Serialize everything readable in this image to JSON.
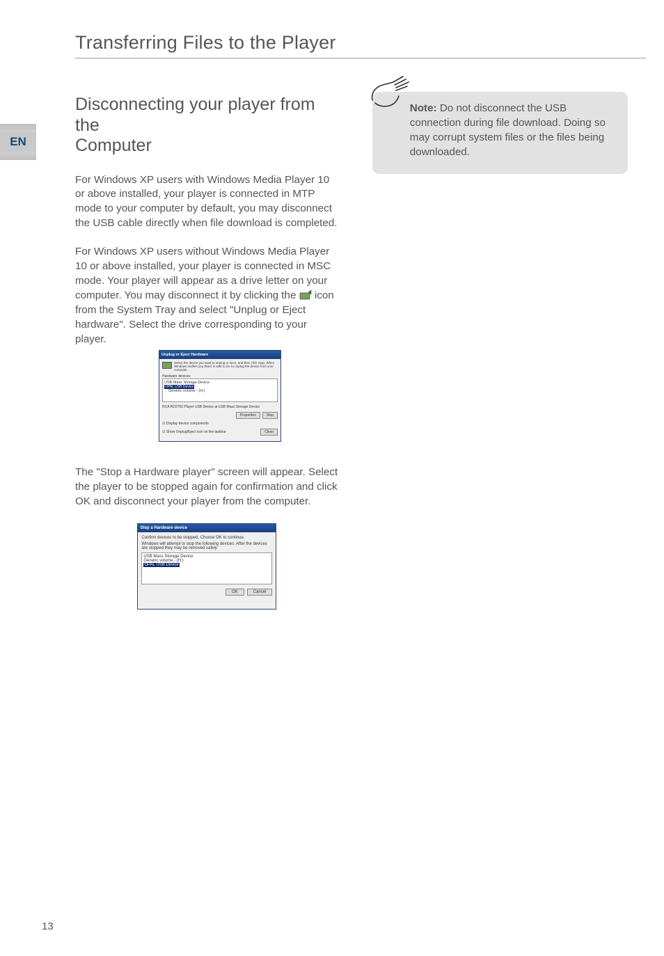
{
  "lang_tab": "EN",
  "section_title": "Transferring Files to the Player",
  "sub_title_line1": "Disconnecting your player from the",
  "sub_title_line2": "Computer",
  "para1": "For Windows XP users with Windows Media Player 10 or above installed, your player is connected in MTP mode to your computer by default, you may disconnect the USB cable directly when file download is completed.",
  "para2_a": "For Windows XP users without Windows Media Player 10 or above installed, your player is connected in MSC  mode. Your player will appear as a drive letter on your computer. You may disconnect it by clicking the ",
  "para2_b": " icon from the System Tray and select \"Unplug or Eject hardware\". Select the drive corresponding to your player.",
  "para3": "The \"Stop a Hardware player\" screen will appear. Select the player to be stopped again for confirmation and click OK and disconnect your player from the computer.",
  "note_label": "Note:",
  "note_body": " Do not disconnect the USB connection during file download. Doing so may corrupt system files or the files being downloaded.",
  "page_number": "13",
  "shot1": {
    "title": "Unplug or Eject Hardware",
    "helper": "Select the device you want to unplug or eject, and then click Stop. When Windows notifies you that it is safe to do so unplug the device from your computer.",
    "hw_label": "Hardware devices:",
    "tree_top": "USB Mass Storage Device",
    "tree_sel": "OPAL USB Device",
    "tree_sub": "Generic volume - (H:)",
    "dev_line": "RCA RD2760 Player USB Device at USB Mass Storage Device",
    "btn_props": "Properties",
    "btn_stop": "Stop",
    "chk1": "Display device components",
    "chk2": "Show Unplug/Eject icon on the taskbar",
    "btn_close": "Close"
  },
  "shot2": {
    "title": "Stop a Hardware device",
    "line1": "Confirm devices to be stopped, Choose OK to continue.",
    "line2": "Windows will attempt to stop the following devices. After the devices are stopped they may be removed safely.",
    "item1": "USB Mass Storage Device",
    "item2": "Generic volume - (H:)",
    "item3": "OPAL USB Device",
    "btn_ok": "OK",
    "btn_cancel": "Cancel"
  }
}
